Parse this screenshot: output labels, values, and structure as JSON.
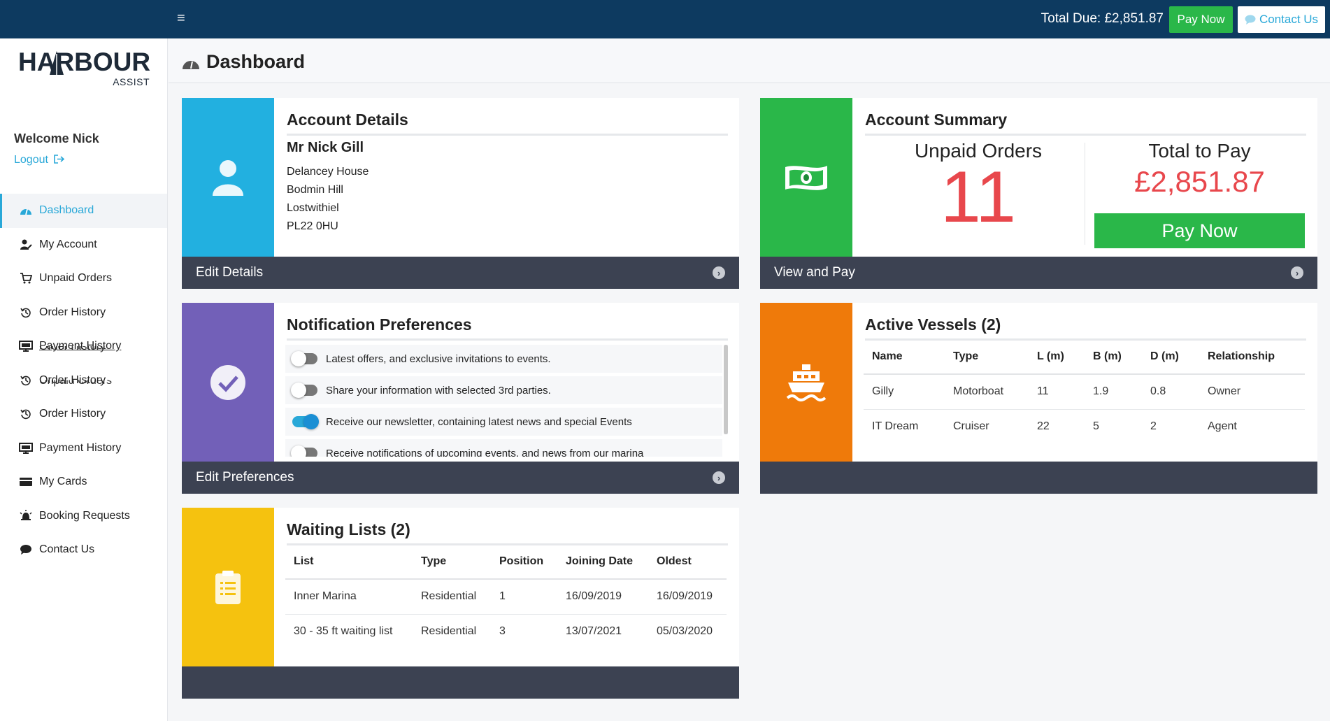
{
  "topbar": {
    "menu_glyph": "≡",
    "total_due": "Total Due: £2,851.87",
    "pay_now": "Pay Now",
    "contact_us": "Contact Us"
  },
  "brand": {
    "main": "HARBOUR",
    "sub": "ASSIST"
  },
  "user": {
    "welcome": "Welcome Nick",
    "logout": "Logout"
  },
  "nav": [
    {
      "label": "Dashboard",
      "icon": "dashboard-icon",
      "active": true
    },
    {
      "label": "My Account",
      "icon": "user-edit-icon"
    },
    {
      "label": "Unpaid Orders",
      "icon": "cart-icon"
    },
    {
      "label": "Order History",
      "icon": "history-icon"
    },
    {
      "label": "Payment History",
      "icon": "monitor-icon",
      "overlap": "Order History"
    },
    {
      "label": "Order History",
      "icon": "history-icon",
      "overlap": "Unpaid Orders"
    },
    {
      "label": "Order History",
      "icon": "history-icon"
    },
    {
      "label": "Payment History",
      "icon": "monitor-icon"
    },
    {
      "label": "My Cards",
      "icon": "card-icon"
    },
    {
      "label": "Booking Requests",
      "icon": "bell-icon"
    },
    {
      "label": "Contact Us",
      "icon": "chat-icon"
    }
  ],
  "page": {
    "title": "Dashboard"
  },
  "account_details": {
    "heading": "Account Details",
    "name": "Mr Nick Gill",
    "address": [
      "Delancey House",
      "Bodmin Hill",
      "Lostwithiel",
      "PL22 0HU"
    ],
    "footer": "Edit Details"
  },
  "account_summary": {
    "heading": "Account Summary",
    "unpaid_label": "Unpaid Orders",
    "unpaid_count": "11",
    "total_label": "Total to Pay",
    "total_value": "£2,851.87",
    "pay_now": "Pay Now",
    "footer": "View and Pay"
  },
  "notifications": {
    "heading": "Notification Preferences",
    "items": [
      {
        "text": "Latest offers, and exclusive invitations to events.",
        "on": false
      },
      {
        "text": "Share your information with selected 3rd parties.",
        "on": false
      },
      {
        "text": "Receive our newsletter, containing latest news and special Events",
        "on": true
      },
      {
        "text": "Receive notifications of upcoming events, and news from our marina",
        "on": false
      }
    ],
    "footer": "Edit Preferences"
  },
  "vessels": {
    "heading": "Active Vessels (2)",
    "columns": [
      "Name",
      "Type",
      "L (m)",
      "B (m)",
      "D (m)",
      "Relationship"
    ],
    "rows": [
      [
        "Gilly",
        "Motorboat",
        "11",
        "1.9",
        "0.8",
        "Owner"
      ],
      [
        "IT Dream",
        "Cruiser",
        "22",
        "5",
        "2",
        "Agent"
      ]
    ]
  },
  "waiting": {
    "heading": "Waiting Lists (2)",
    "columns": [
      "List",
      "Type",
      "Position",
      "Joining Date",
      "Oldest"
    ],
    "rows": [
      [
        "Inner Marina",
        "Residential",
        "1",
        "16/09/2019",
        "16/09/2019"
      ],
      [
        "30 - 35 ft waiting list",
        "Residential",
        "3",
        "13/07/2021",
        "05/03/2020"
      ]
    ]
  },
  "colors": {
    "topbar": "#0d3a60",
    "blue": "#22b0e0",
    "green": "#2ab749",
    "purple": "#7260b8",
    "orange": "#ef7a0a",
    "yellow": "#f5c20f",
    "footer": "#3c4252",
    "red": "#e8474c"
  }
}
